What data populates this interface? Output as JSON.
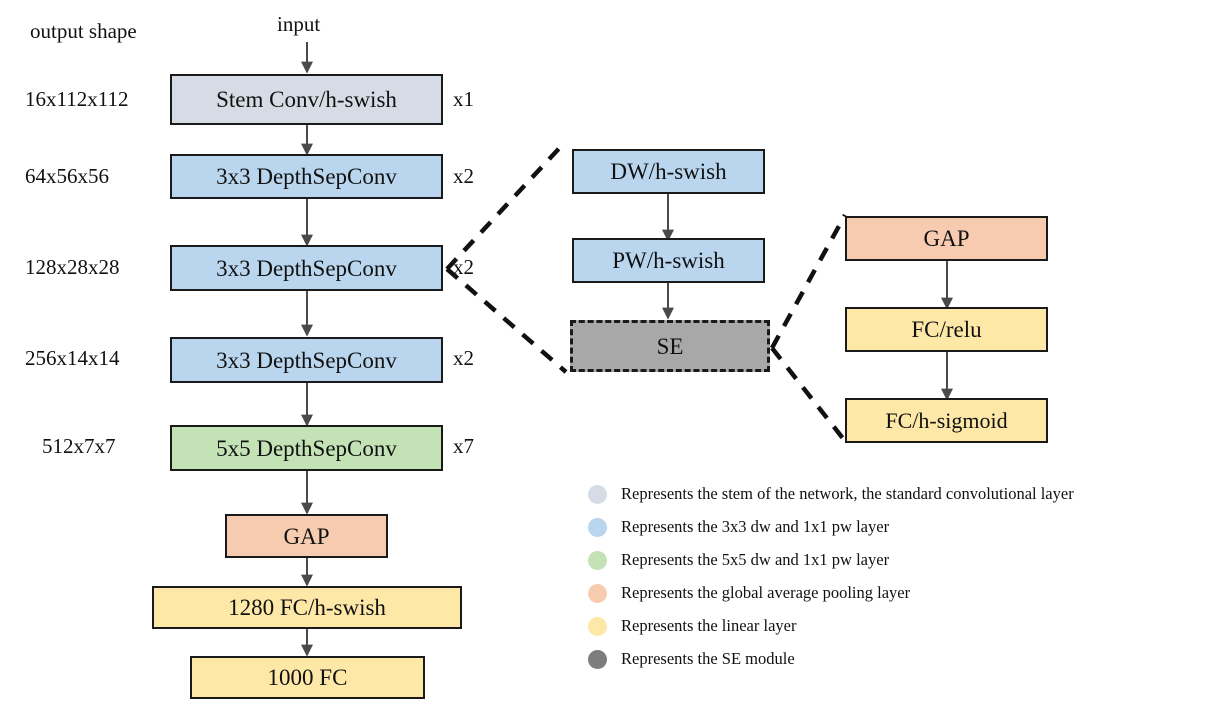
{
  "figure": {
    "axis_label": "output shape",
    "input_label": "input"
  },
  "colors": {
    "stem": "#d5dce5",
    "blue": "#b9d6ee",
    "green": "#c3e2b5",
    "salmon": "#f7cbb0",
    "yellow": "#fde8a8",
    "gray": "#a8a8a8",
    "outline": "#1a1a1a"
  },
  "main_column": {
    "blocks": [
      {
        "label": "Stem Conv/h-swish",
        "shape": "16x112x112",
        "multiplier": "x1",
        "color": "stem"
      },
      {
        "label": "3x3 DepthSepConv",
        "shape": "64x56x56",
        "multiplier": "x2",
        "color": "blue"
      },
      {
        "label": "3x3 DepthSepConv",
        "shape": "128x28x28",
        "multiplier": "x2",
        "color": "blue"
      },
      {
        "label": "3x3 DepthSepConv",
        "shape": "256x14x14",
        "multiplier": "x2",
        "color": "blue"
      },
      {
        "label": "5x5 DepthSepConv",
        "shape": "512x7x7",
        "multiplier": "x7",
        "color": "green"
      },
      {
        "label": "GAP",
        "shape": "",
        "multiplier": "",
        "color": "salmon"
      },
      {
        "label": "1280 FC/h-swish",
        "shape": "",
        "multiplier": "",
        "color": "yellow"
      },
      {
        "label": "1000 FC",
        "shape": "",
        "multiplier": "",
        "color": "yellow"
      }
    ]
  },
  "block_detail": {
    "blocks": [
      {
        "label": "DW/h-swish",
        "color": "blue"
      },
      {
        "label": "PW/h-swish",
        "color": "blue"
      },
      {
        "label": "SE",
        "color": "gray"
      }
    ]
  },
  "se_detail": {
    "blocks": [
      {
        "label": "GAP",
        "color": "salmon"
      },
      {
        "label": "FC/relu",
        "color": "yellow"
      },
      {
        "label": "FC/h-sigmoid",
        "color": "yellow"
      }
    ]
  },
  "legend": {
    "items": [
      {
        "color": "stem",
        "text": "Represents the stem of the network, the standard convolutional layer"
      },
      {
        "color": "blue",
        "text": "Represents the 3x3 dw and 1x1 pw layer"
      },
      {
        "color": "green",
        "text": "Represents the 5x5 dw and 1x1 pw layer"
      },
      {
        "color": "salmon",
        "text": "Represents the global average pooling layer"
      },
      {
        "color": "yellow",
        "text": "Represents the linear layer"
      },
      {
        "color": "gray",
        "text": "Represents the SE module"
      }
    ]
  }
}
